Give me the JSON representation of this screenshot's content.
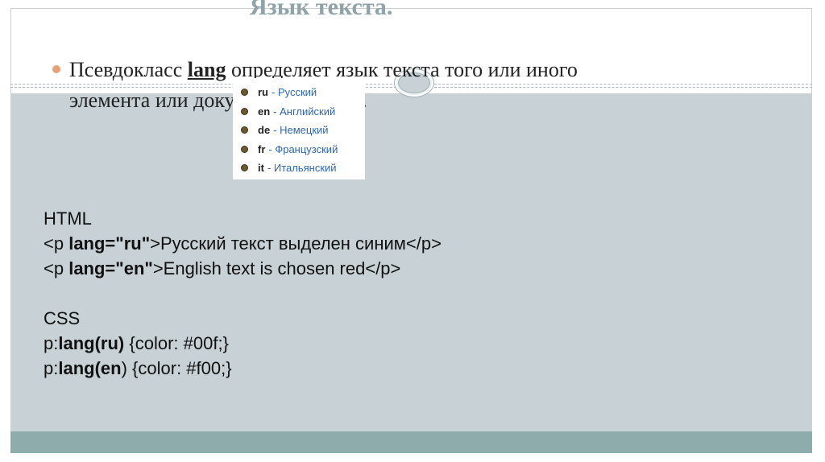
{
  "title": "Язык текста.",
  "bullet": {
    "part1": "Псевдокласс ",
    "keyword": "lang",
    "part2": " определяет язык текста того или иного элемента или документа в целом."
  },
  "languages": [
    {
      "code": "ru",
      "name": "- Русский"
    },
    {
      "code": "en",
      "name": "- Английский"
    },
    {
      "code": "de",
      "name": "- Немецкий"
    },
    {
      "code": "fr",
      "name": "- Французский"
    },
    {
      "code": "it",
      "name": "- Итальянский"
    }
  ],
  "code": {
    "html_label": "HTML",
    "html_line1": {
      "pre": "<p ",
      "bold": "lang=\"ru\"",
      "post": ">Русский текст выделен синим</p>"
    },
    "html_line2": {
      "pre": "<p ",
      "bold": "lang=\"en\"",
      "post": ">English text is chosen red</p>"
    },
    "css_label": "CSS",
    "css_line1": {
      "pre": "p:",
      "bold": "lang(ru)",
      "post": " {color: #00f;}"
    },
    "css_line2": {
      "pre": "p:",
      "bold": "lang(en",
      "post": ") {color: #f00;}"
    }
  },
  "colors": {
    "panel": "#c7d1d6",
    "footer": "#8eacac",
    "title": "#8fa3a8",
    "bullet": "#e8a077"
  }
}
